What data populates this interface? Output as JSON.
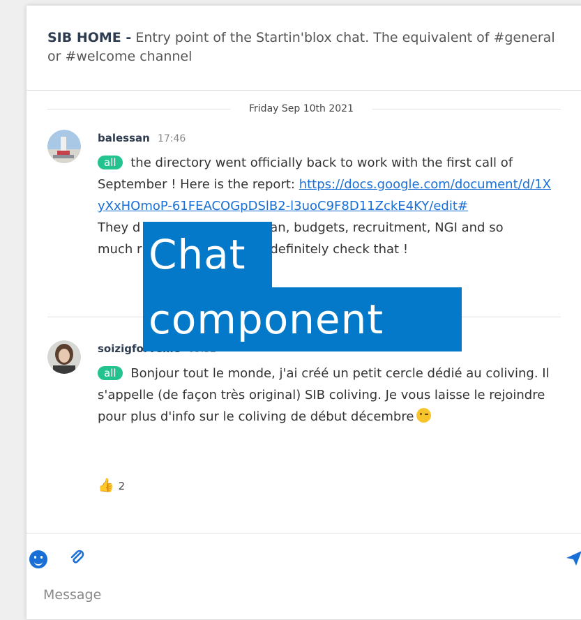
{
  "channel": {
    "name": "SIB HOME -",
    "description": " Entry point of the Startin'blox chat. The equivalent of #general or #welcome channel"
  },
  "date_separator": "Friday Sep 10th 2021",
  "messages": [
    {
      "author": "balessan",
      "time": "17:46",
      "mention": "all",
      "text_before_link": " the directory went officially back to work with the first call of September ! Here is the report: ",
      "link": "https://docs.google.com/document/d/1XyXxHOmoP-61FEACOGpDSlB2-l3uoC9F8D11ZckE4KY/edit#",
      "text_after_link_partial": "They d",
      "text_after_link_rest": "an, budgets, recruitment, NGI and so",
      "text_line2_partial": "much r",
      "text_line2_rest": "definitely check that !"
    },
    {
      "author": "soizigforveille",
      "time": "09:32",
      "mention": "all",
      "text": " Bonjour tout le monde, j'ai créé un petit cercle dédié au coliving. Il s'appelle (de façon très original) SIB coliving. Je vous laisse le rejoindre pour plus d'info sur le coliving de début décembre",
      "reaction_count": "2"
    }
  ],
  "overlay": {
    "line1": "Chat",
    "line2": "component"
  },
  "composer": {
    "placeholder": "Message"
  },
  "colors": {
    "accent": "#1a6fd6",
    "mention_badge": "#22c38e",
    "overlay": "#0479c9"
  },
  "icons": [
    "smiley-icon",
    "paperclip-icon",
    "send-icon",
    "thumbs-up-icon"
  ]
}
